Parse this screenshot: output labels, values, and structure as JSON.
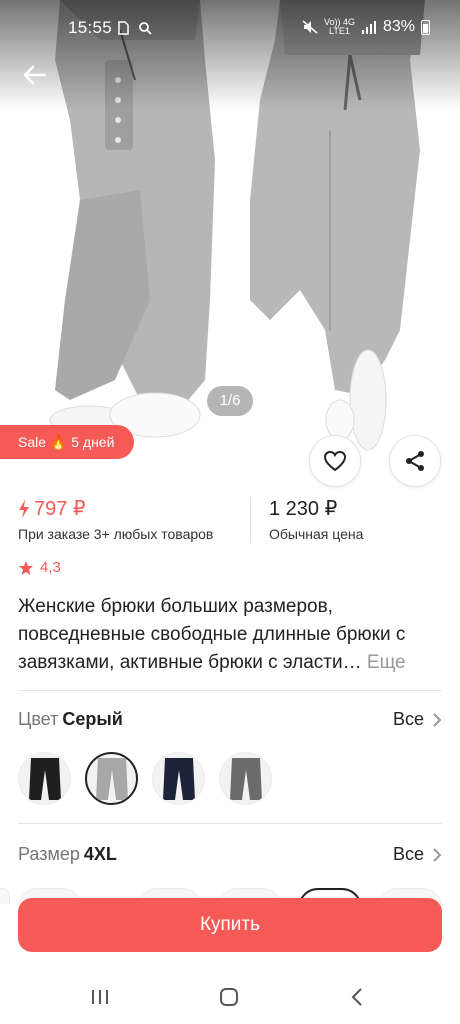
{
  "status_bar": {
    "time": "15:55",
    "battery": "83%",
    "network_line1": "Vo)) 4G",
    "network_line2": "LTE1"
  },
  "gallery": {
    "counter": "1/6"
  },
  "sale_badge": {
    "label": "Sale 🔥 5 дней"
  },
  "price": {
    "sale_price": "797 ₽",
    "sale_note": "При заказе 3+ любых товаров",
    "regular_price": "1 230 ₽",
    "regular_note": "Обычная цена"
  },
  "rating": {
    "value": "4,3"
  },
  "product": {
    "title": "Женские брюки больших размеров, повседневные свободные длинные брюки с завязками, активные брюки с эласти…",
    "more_label": "Еще"
  },
  "color_option": {
    "label": "Цвет",
    "value": "Серый",
    "all_label": "Все",
    "swatches": [
      {
        "color": "#1f1f1f"
      },
      {
        "color": "#9a9a9a"
      },
      {
        "color": "#1c2338"
      },
      {
        "color": "#6b6b6b"
      }
    ]
  },
  "size_option": {
    "label": "Размер",
    "value": "4XL",
    "all_label": "Все"
  },
  "buy_button": {
    "label": "Купить"
  },
  "colors": {
    "accent": "#f55a56"
  }
}
